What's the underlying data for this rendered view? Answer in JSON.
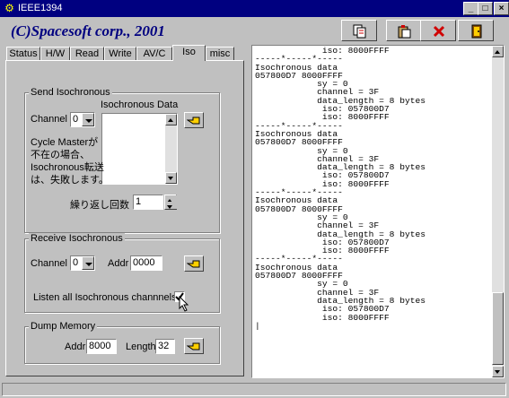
{
  "window": {
    "title": "IEEE1394",
    "brand": "(C)Spacesoft corp., 2001"
  },
  "toolbar": [
    {
      "name": "toolbar-copy-button"
    },
    {
      "name": "toolbar-paste-button"
    },
    {
      "name": "toolbar-clear-button"
    },
    {
      "name": "toolbar-exit-button"
    }
  ],
  "tabs": [
    "Status",
    "H/W",
    "Read",
    "Write",
    "AV/C",
    "Iso",
    "misc"
  ],
  "send": {
    "title": "Send Isochronous",
    "channel_label": "Channel",
    "channel_value": "0",
    "data_label": "Isochronous Data",
    "note": [
      "Cycle Masterが",
      "不在の場合、",
      "Isochronous転送",
      "は、失敗します。"
    ],
    "repeat_label": "繰り返し回数",
    "repeat_value": "1"
  },
  "receive": {
    "title": "Receive Isochronous",
    "channel_label": "Channel",
    "channel_value": "0",
    "addr_label": "Addr",
    "addr_value": "0000",
    "listen_label": "Listen all Isochronous channnels",
    "listen_checked": true
  },
  "dump": {
    "title": "Dump Memory",
    "addr_label": "Addr",
    "addr_value": "8000",
    "length_label": "Length",
    "length_value": "32"
  },
  "log": {
    "text": "             iso: 8000FFFF\n-----*-----*-----\nIsochronous data\n057800D7 8000FFFF\n            sy = 0\n            channel = 3F\n            data_length = 8 bytes\n             iso: 057800D7\n             iso: 8000FFFF\n-----*-----*-----\nIsochronous data\n057800D7 8000FFFF\n            sy = 0\n            channel = 3F\n            data_length = 8 bytes\n             iso: 057800D7\n             iso: 8000FFFF\n-----*-----*-----\nIsochronous data\n057800D7 8000FFFF\n            sy = 0\n            channel = 3F\n            data_length = 8 bytes\n             iso: 057800D7\n             iso: 8000FFFF\n-----*-----*-----\nIsochronous data\n057800D7 8000FFFF\n            sy = 0\n            channel = 3F\n            data_length = 8 bytes\n             iso: 057800D7\n             iso: 8000FFFF\n|"
  }
}
